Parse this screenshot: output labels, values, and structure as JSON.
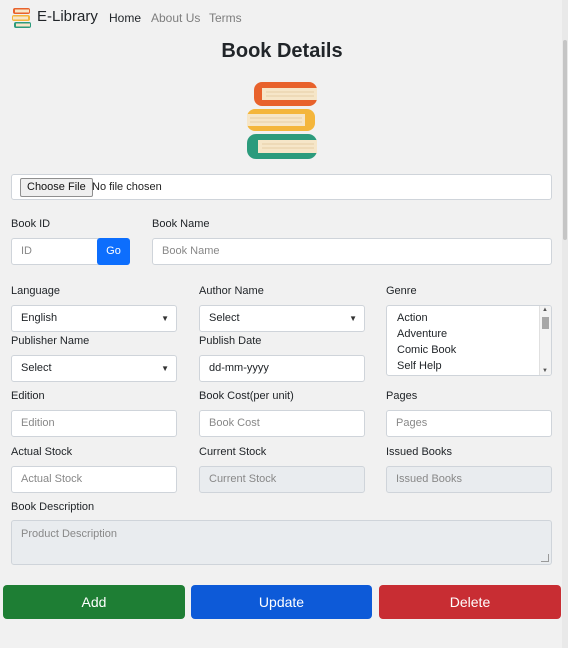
{
  "nav": {
    "brand": "E-Library",
    "links": [
      {
        "label": "Home",
        "active": true
      },
      {
        "label": "About Us",
        "active": false
      },
      {
        "label": "Terms",
        "active": false
      }
    ]
  },
  "page": {
    "title": "Book Details",
    "image_icon": "books-stack-icon"
  },
  "file_input": {
    "button_label": "Choose File",
    "status": "No file chosen"
  },
  "book_id": {
    "label": "Book ID",
    "placeholder": "ID",
    "go_label": "Go"
  },
  "book_name": {
    "label": "Book Name",
    "placeholder": "Book Name"
  },
  "language": {
    "label": "Language",
    "value": "English"
  },
  "author_name": {
    "label": "Author Name",
    "value": "Select"
  },
  "genre": {
    "label": "Genre",
    "options": [
      "Action",
      "Adventure",
      "Comic Book",
      "Self Help"
    ]
  },
  "publisher_name": {
    "label": "Publisher Name",
    "value": "Select"
  },
  "publish_date": {
    "label": "Publish Date",
    "value": "dd-mm-yyyy"
  },
  "edition": {
    "label": "Edition",
    "placeholder": "Edition"
  },
  "book_cost": {
    "label": "Book Cost(per unit)",
    "placeholder": "Book Cost"
  },
  "pages": {
    "label": "Pages",
    "placeholder": "Pages"
  },
  "actual_stock": {
    "label": "Actual Stock",
    "placeholder": "Actual Stock"
  },
  "current_stock": {
    "label": "Current Stock",
    "placeholder": "Current Stock"
  },
  "issued_books": {
    "label": "Issued Books",
    "placeholder": "Issued Books"
  },
  "book_description": {
    "label": "Book Description",
    "placeholder": "Product Description"
  },
  "actions": {
    "add": "Add",
    "update": "Update",
    "delete": "Delete"
  },
  "colors": {
    "add": "#1e7e34",
    "update": "#0d5ad8",
    "delete": "#c82d33",
    "go": "#0d6efd"
  }
}
